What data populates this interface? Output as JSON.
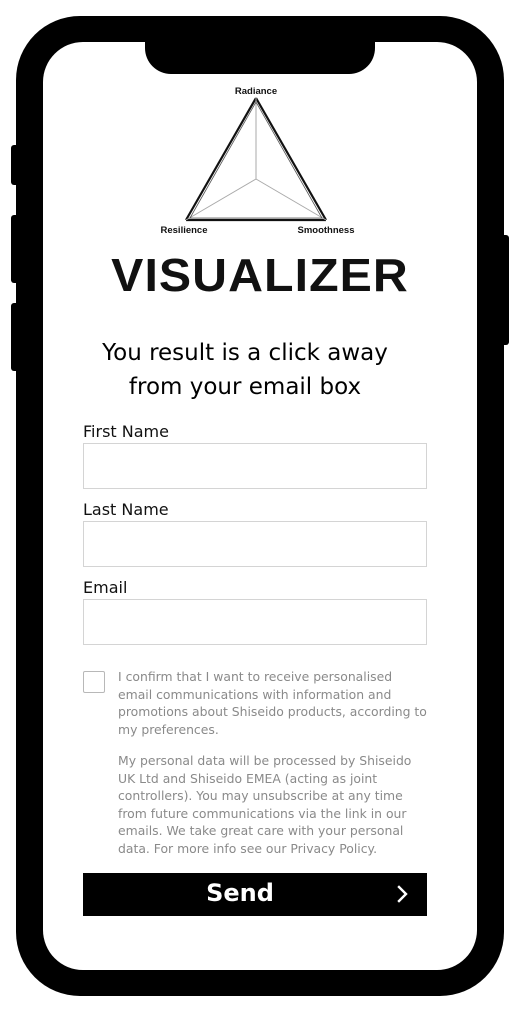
{
  "logo": {
    "top_label": "Radiance",
    "left_label": "Resilience",
    "right_label": "Smoothness",
    "wordmark": "VISUALIZER"
  },
  "headline": {
    "line1": "You result is a click away",
    "line2": "from your email box"
  },
  "form": {
    "first_name_label": "First Name",
    "first_name_value": "",
    "last_name_label": "Last Name",
    "last_name_value": "",
    "email_label": "Email",
    "email_value": "",
    "consent_checked": false,
    "consent_text": "I confirm that I want to receive personalised email communications with information and promotions about Shiseido products, according to my preferences.",
    "privacy_text": "My personal data will be processed by Shiseido UK Ltd and Shiseido EMEA (acting as joint controllers). You may unsubscribe at any time from future communications via the link in our emails. We take great care with your personal data. For more info see our Privacy Policy.",
    "send_label": "Send",
    "send_icon": "chevron-right-icon"
  },
  "colors": {
    "frame": "#000000",
    "button_bg": "#000000",
    "button_text": "#ffffff",
    "muted_text": "#8a8a8a",
    "input_border": "#d4d4d4"
  }
}
